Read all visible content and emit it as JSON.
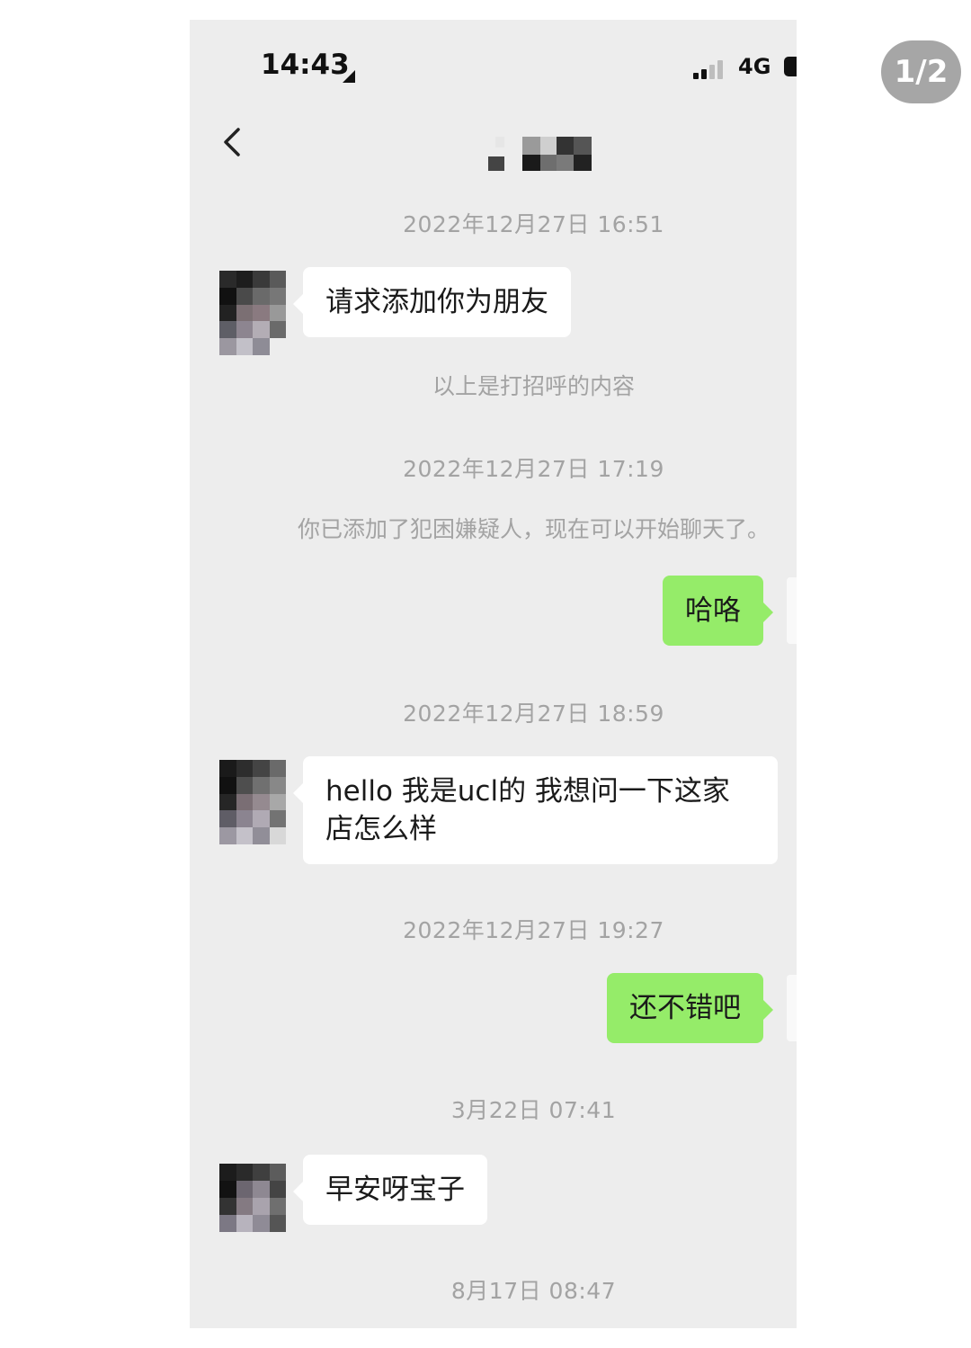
{
  "status_bar": {
    "time": "14:43",
    "network": "4G"
  },
  "header": {
    "back_icon": "chevron-left-icon",
    "contact_name_obscured": true
  },
  "chat": [
    {
      "type": "time",
      "text": "2022年12月27日 16:51"
    },
    {
      "type": "incoming",
      "text": "请求添加你为朋友"
    },
    {
      "type": "system",
      "text": "以上是打招呼的内容"
    },
    {
      "type": "time",
      "text": "2022年12月27日 17:19"
    },
    {
      "type": "system",
      "text": "你已添加了犯困嫌疑人，现在可以开始聊天了。"
    },
    {
      "type": "outgoing",
      "text": "哈咯"
    },
    {
      "type": "time",
      "text": "2022年12月27日 18:59"
    },
    {
      "type": "incoming",
      "text": "hello 我是ucl的 我想问一下这家店怎么样"
    },
    {
      "type": "time",
      "text": "2022年12月27日 19:27"
    },
    {
      "type": "outgoing",
      "text": "还不错吧"
    },
    {
      "type": "time",
      "text": "3月22日 07:41"
    },
    {
      "type": "incoming",
      "text": "早安呀宝子"
    },
    {
      "type": "time",
      "text": "8月17日 08:47"
    }
  ],
  "page_indicator": "1/2",
  "colors": {
    "chat_background": "#ededed",
    "outgoing_bubble": "#95ec69",
    "incoming_bubble": "#ffffff",
    "timestamp_text": "#a3a3a3"
  }
}
